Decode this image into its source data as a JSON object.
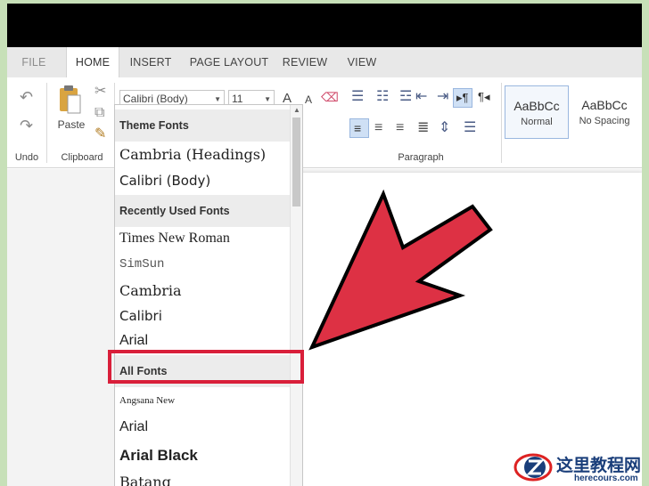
{
  "tabs": [
    "FILE",
    "HOME",
    "INSERT",
    "PAGE LAYOUT",
    "REVIEW",
    "VIEW"
  ],
  "active_tab": "HOME",
  "ribbon": {
    "undo_group_label": "Undo",
    "clipboard_group_label": "Clipboard",
    "paragraph_group_label": "Paragraph",
    "paste_label": "Paste",
    "font_name": "Calibri (Body)",
    "font_size": "11",
    "grow_font_glyph": "A",
    "shrink_font_glyph": "A"
  },
  "styles": [
    {
      "sample": "AaBbCc",
      "name": "Normal"
    },
    {
      "sample": "AaBbCc",
      "name": "No Spacing"
    }
  ],
  "font_dropdown": {
    "theme_fonts_header": "Theme Fonts",
    "theme_fonts": [
      "Cambria (Headings)",
      "Calibri (Body)"
    ],
    "recent_header": "Recently Used Fonts",
    "recent_fonts": [
      "Times New Roman",
      "SimSun",
      "Cambria",
      "Calibri",
      "Arial"
    ],
    "all_fonts_header": "All Fonts",
    "all_fonts": [
      "Angsana New",
      "Arial",
      "Arial Black",
      "Batang"
    ]
  },
  "watermark": {
    "title": "这里教程网",
    "subtitle": "herecours.com"
  },
  "colors": {
    "highlight": "#d91f3a",
    "arrow_fill": "#dd3144",
    "background_green": "#c7e0b8"
  }
}
